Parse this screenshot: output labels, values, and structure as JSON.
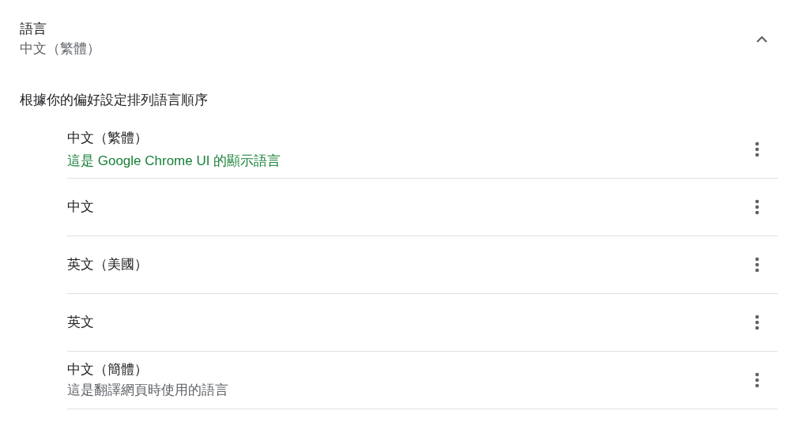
{
  "section": {
    "title": "語言",
    "subtitle": "中文（繁體）",
    "expanded": true
  },
  "description": "根據你的偏好設定排列語言順序",
  "languages": [
    {
      "name": "中文（繁體）",
      "note": "這是 Google Chrome UI 的顯示語言",
      "kind": "ui"
    },
    {
      "name": "中文"
    },
    {
      "name": "英文（美國）"
    },
    {
      "name": "英文"
    },
    {
      "name": "中文（簡體）",
      "note": "這是翻譯網頁時使用的語言",
      "kind": "translate"
    }
  ]
}
